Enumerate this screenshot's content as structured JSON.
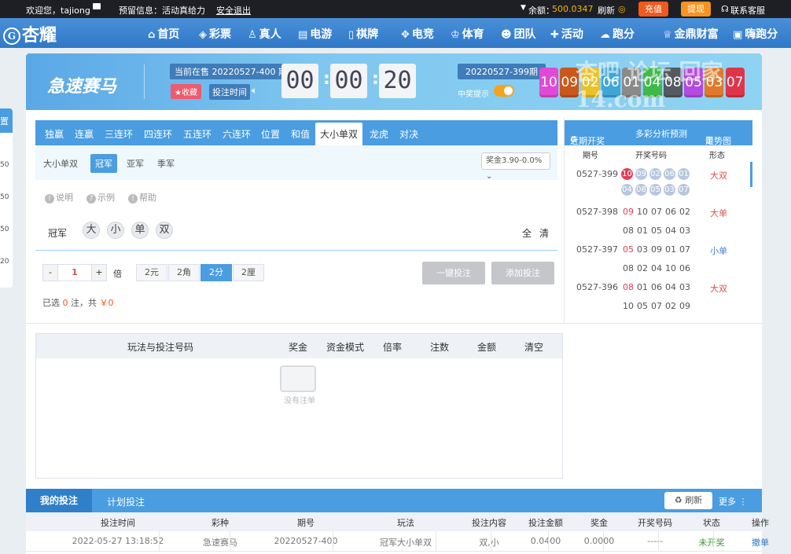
{
  "topbar": {
    "welcome": "欢迎您，tajiong",
    "notice": "预留信息：活动真给力",
    "logout": "安全退出",
    "balance_label": "余额：",
    "balance": "500.0347",
    "refresh": "刷新",
    "recharge": "充值",
    "withdraw": "提现",
    "service": "联系客服",
    "recharge_color": "#f05a1c",
    "withdraw_color": "#f7931e"
  },
  "logo": {
    "text": "杏耀"
  },
  "nav": [
    "首页",
    "彩票",
    "真人",
    "电游",
    "棋牌",
    "电竞",
    "体育",
    "团队",
    "活动",
    "跑分",
    "金鼎财富",
    "嗨跑分"
  ],
  "nav_icons": [
    "home-icon",
    "ticket-icon",
    "person-icon",
    "slot-icon",
    "cards-icon",
    "gamepad-icon",
    "trophy-icon",
    "team-icon",
    "gift-icon",
    "cloud-icon",
    "crown-icon",
    "hi-icon"
  ],
  "left_stub": [
    "置",
    "50",
    "50",
    "50",
    "20"
  ],
  "game": {
    "title": "急速赛马",
    "current_label": "当前在售 20220527-400 期",
    "favorite": "收藏",
    "bet_time": "投注时间",
    "countdown": [
      "00",
      "00",
      "20"
    ],
    "prev_issue": "20220527-399期",
    "win_tip": "中奖提示"
  },
  "balls": {
    "values": [
      "10",
      "09",
      "02",
      "06",
      "01",
      "04",
      "08",
      "05",
      "03",
      "07"
    ],
    "colors": [
      "#e04ad6",
      "#c9581a",
      "#e8c227",
      "#3fa6d6",
      "#8a8a8a",
      "#3fb94a",
      "#555a60",
      "#b44ae0",
      "#e07a28",
      "#e0344a"
    ]
  },
  "watermark": "杏吧 论坛 回家14.com",
  "tabs": [
    "独赢",
    "连赢",
    "三连环",
    "四连环",
    "五连环",
    "六连环",
    "位置",
    "和值",
    "大小单双",
    "龙虎",
    "对决"
  ],
  "subtabs": {
    "label": "大小单双",
    "items": [
      "冠军",
      "亚军",
      "季军"
    ]
  },
  "bonus": "奖金3.90-0.0%",
  "help": [
    "说明",
    "示例",
    "帮助"
  ],
  "pick": {
    "position": "冠军",
    "options": [
      "大",
      "小",
      "单",
      "双"
    ],
    "all": "全",
    "clear": "清"
  },
  "multiplier": {
    "minus": "-",
    "value": "1",
    "plus": "+",
    "label": "倍"
  },
  "units": [
    "2元",
    "2角",
    "2分",
    "2厘"
  ],
  "actions": {
    "quick": "一键投注",
    "add": "添加投注"
  },
  "selected": {
    "prefix": "已选",
    "count": "0",
    "mid": "注，共",
    "amount": "￥0"
  },
  "recent": {
    "header": [
      "近期开奖",
      "多彩分析预测",
      "走势图"
    ],
    "cols": [
      "期号",
      "开奖号码",
      "形态"
    ],
    "rows": [
      {
        "issue": "0527-399",
        "nums": [
          "10",
          "09",
          "02",
          "06",
          "01",
          "04",
          "08",
          "05",
          "03",
          "07"
        ],
        "shape": "大双"
      },
      {
        "issue": "0527-398",
        "nums": [
          "09",
          "10",
          "07",
          "06",
          "02",
          "08",
          "01",
          "05",
          "04",
          "03"
        ],
        "shape": "大单"
      },
      {
        "issue": "0527-397",
        "nums": [
          "05",
          "03",
          "09",
          "01",
          "07",
          "08",
          "02",
          "04",
          "10",
          "06"
        ],
        "shape": "小单"
      },
      {
        "issue": "0527-396",
        "nums": [
          "08",
          "01",
          "06",
          "04",
          "03",
          "10",
          "05",
          "07",
          "02",
          "09"
        ],
        "shape": "大双"
      }
    ]
  },
  "bet_table": {
    "headers": [
      "玩法与投注号码",
      "奖金",
      "资金模式",
      "倍率",
      "注数",
      "金额",
      "清空"
    ],
    "empty": "没有注单"
  },
  "bottom": {
    "tabs": [
      "我的投注",
      "计划投注"
    ],
    "refresh": "刷新",
    "more": "更多",
    "headers": [
      "投注时间",
      "彩种",
      "期号",
      "玩法",
      "投注内容",
      "投注金额",
      "奖金",
      "开奖号码",
      "状态",
      "操作"
    ],
    "row": [
      "2022-05-27 13:18:52",
      "急速赛马",
      "20220527-400",
      "冠军大小单双",
      "双,小",
      "0.0400",
      "0.0000",
      "-----",
      "未开奖",
      "撤单"
    ]
  }
}
